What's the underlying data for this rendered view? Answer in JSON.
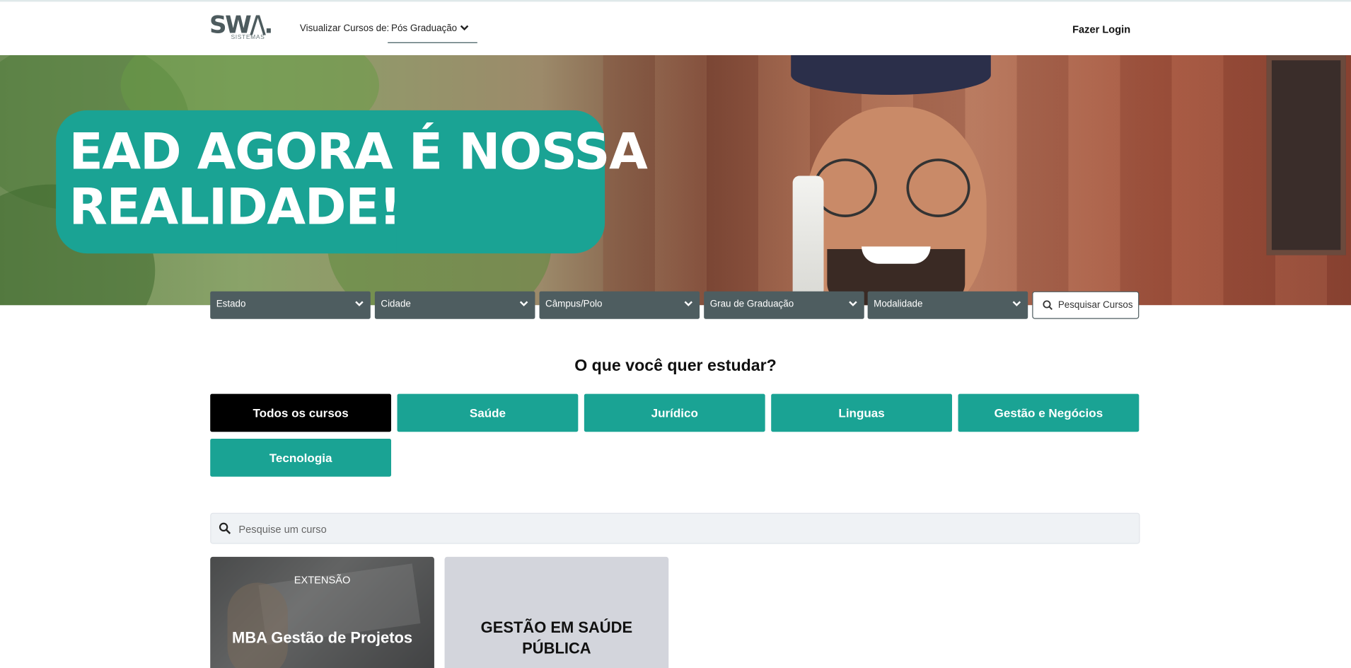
{
  "header": {
    "logo_text": "SW/\\.",
    "logo_subtext": "SISTEMAS",
    "view_courses_label": "Visualizar Cursos de:",
    "view_courses_value": "Pós Graduação",
    "login_label": "Fazer Login"
  },
  "hero": {
    "headline_line1": "EAD AGORA É NOSSA",
    "headline_line2": "REALIDADE!"
  },
  "filters": [
    {
      "label": "Estado"
    },
    {
      "label": "Cidade"
    },
    {
      "label": "Câmpus/Polo"
    },
    {
      "label": "Grau de Graduação"
    },
    {
      "label": "Modalidade"
    }
  ],
  "search_courses_button": "Pesquisar Cursos",
  "question": "O que você quer estudar?",
  "categories": [
    {
      "label": "Todos os cursos",
      "active": true
    },
    {
      "label": "Saúde",
      "active": false
    },
    {
      "label": "Jurídico",
      "active": false
    },
    {
      "label": "Linguas",
      "active": false
    },
    {
      "label": "Gestão e Negócios",
      "active": false
    },
    {
      "label": "Tecnologia",
      "active": false
    }
  ],
  "course_search": {
    "placeholder": "Pesquise um curso",
    "value": ""
  },
  "cards": [
    {
      "tag": "EXTENSÃO",
      "title": "MBA Gestão de Projetos"
    },
    {
      "tag": "",
      "title": "GESTÃO EM SAÚDE PÚBLICA"
    }
  ],
  "colors": {
    "accent": "#1aa394",
    "filter_bg": "#4e5d60",
    "active_category": "#000000",
    "card_gray": "#d3d5dc"
  }
}
